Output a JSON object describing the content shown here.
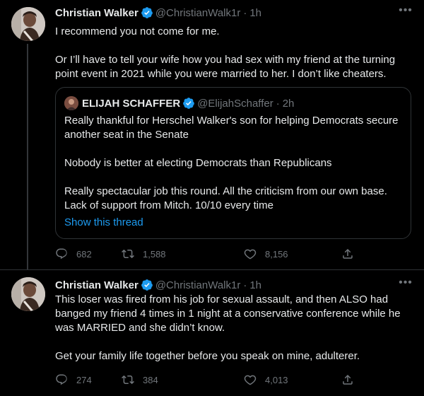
{
  "tweets": [
    {
      "author_name": "Christian Walker",
      "handle": "@ChristianWalk1r",
      "separator": "·",
      "time": "1h",
      "text": "I recommend you not come for me.\n\nOr I’ll have to tell your wife how you had sex with my friend at the turning point event in 2021 while you were married to her. I don’t like cheaters.",
      "quote": {
        "author_name": "ELIJAH SCHAFFER",
        "handle": "@ElijahSchaffer",
        "separator": "·",
        "time": "2h",
        "text": "Really thankful for Herschel Walker's son for helping Democrats secure another seat in the Senate\n\nNobody is better at electing Democrats than Republicans\n\nReally spectacular job this round. All the criticism from our own base. Lack of support from Mitch. 10/10 every time",
        "show_thread": "Show this thread"
      },
      "stats": {
        "replies": "682",
        "retweets": "1,588",
        "likes": "8,156"
      }
    },
    {
      "author_name": "Christian Walker",
      "handle": "@ChristianWalk1r",
      "separator": "·",
      "time": "1h",
      "text": "This loser was fired from his job for sexual assault, and then ALSO had banged my friend 4 times in 1 night at a conservative conference while he was MARRIED and she didn’t know.\n\nGet your family life together before you speak on mine, adulterer.",
      "stats": {
        "replies": "274",
        "retweets": "384",
        "likes": "4,013"
      }
    }
  ],
  "icons": {
    "more": "more-icon",
    "verified": "verified-badge-icon",
    "reply": "reply-icon",
    "retweet": "retweet-icon",
    "like": "like-icon",
    "share": "share-icon"
  },
  "colors": {
    "background": "#000000",
    "text": "#e7e9ea",
    "secondary": "#71767b",
    "accent": "#1d9bf0",
    "border": "#2f3336"
  }
}
